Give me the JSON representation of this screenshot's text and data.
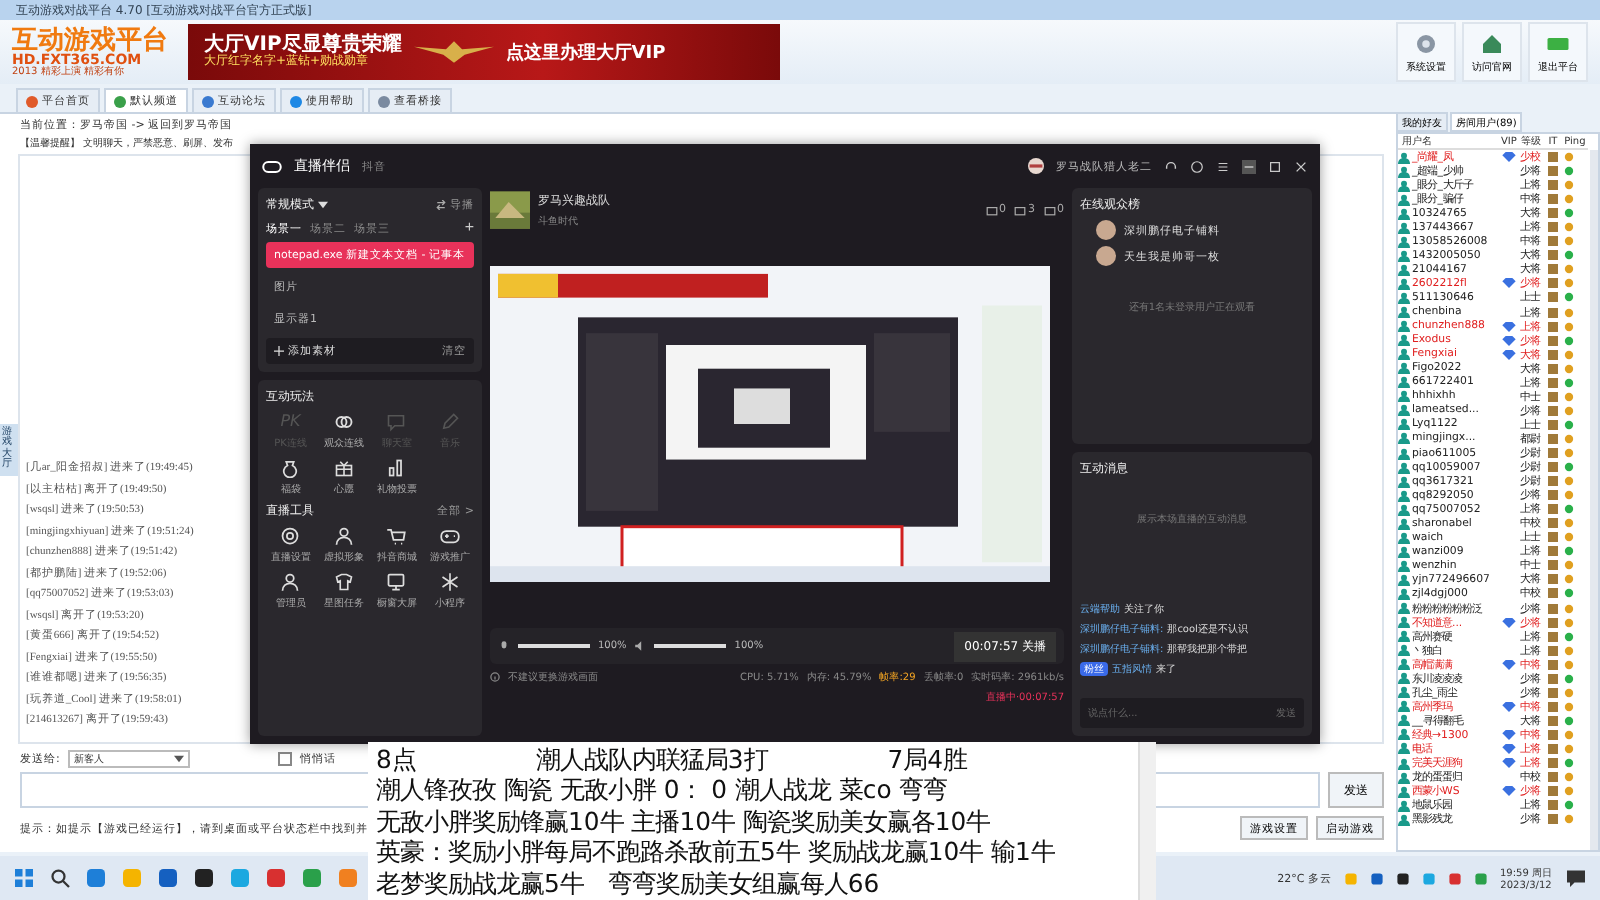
{
  "window": {
    "title": "互动游戏对战平台 4.70 [互动游戏对战平台官方正式版]"
  },
  "logo": {
    "name": "互动游戏平台",
    "url": "HD.FXT365.COM",
    "tagline": "2013 精彩上演 精彩有你"
  },
  "banner": {
    "title": "大厅VIP尽显尊贵荣耀",
    "subtitle": "大厅红字名字+蓝钻+勋战勋章",
    "cta": "点这里办理大厅VIP"
  },
  "toolbar": [
    "系统设置",
    "访问官网",
    "退出平台"
  ],
  "tabs": [
    {
      "label": "平台首页",
      "selected": false
    },
    {
      "label": "默认频道",
      "selected": true
    },
    {
      "label": "互动论坛",
      "selected": false
    },
    {
      "label": "使用帮助",
      "selected": false
    },
    {
      "label": "查看桥接",
      "selected": false
    }
  ],
  "breadcrumb": "当前位置：罗马帝国 -> 返回到罗马帝国",
  "notice": "【温馨提醒】 文明聊天，严禁恶意、刷屏、发布",
  "side_tab": "游戏大厅",
  "log": [
    "[几ar_阳金招叔] 进来了(19:49:45)",
    "[以主枯枯] 离开了(19:49:50)",
    "[wsqsl] 进来了(19:50:53)",
    "[mingjingxhiyuan] 进来了(19:51:24)",
    "[chunzhen888] 进来了(19:51:42)",
    "[都护鹏陆] 进来了(19:52:06)",
    "[qq75007052] 进来了(19:53:03)",
    "[wsqsl] 离开了(19:53:20)",
    "[黄蛋666] 离开了(19:54:52)",
    "[Fengxiai] 进来了(19:55:50)",
    "[谁谁都嗯] 进来了(19:56:35)",
    "[玩养道_Cool] 进来了(19:58:01)",
    "[214613267] 离开了(19:59:43)"
  ],
  "send": {
    "label": "发送给:",
    "target": "新客人",
    "private_label": "悄悄话",
    "private": false,
    "button": "发送"
  },
  "hint": "提示：如提示【游戏已经运行】，请到桌面或平台状态栏中找到并",
  "actions": [
    "游戏设置",
    "启动游戏"
  ],
  "user_panel": {
    "tabs": [
      {
        "label": "我的好友",
        "selected": false
      },
      {
        "label": "房间用户(89)",
        "selected": true
      }
    ],
    "columns": [
      "用户名",
      "VIP",
      "等级",
      "IT",
      "Ping"
    ],
    "users": [
      {
        "name": "_尚耀_凤",
        "highlight": true,
        "vip": true,
        "level": "少校"
      },
      {
        "name": "_超端_少帅",
        "highlight": false,
        "vip": false,
        "level": "少将"
      },
      {
        "name": "_眼分_大斤子",
        "highlight": false,
        "vip": false,
        "level": "上将"
      },
      {
        "name": "_眼分_骗仔",
        "highlight": false,
        "vip": false,
        "level": "中将"
      },
      {
        "name": "10324765",
        "highlight": false,
        "vip": false,
        "level": "大将"
      },
      {
        "name": "137443667",
        "highlight": false,
        "vip": false,
        "level": "上将"
      },
      {
        "name": "13058526008",
        "highlight": false,
        "vip": false,
        "level": "中将"
      },
      {
        "name": "1432005050",
        "highlight": false,
        "vip": false,
        "level": "大将"
      },
      {
        "name": "21044167",
        "highlight": false,
        "vip": false,
        "level": "大将"
      },
      {
        "name": "2602212fl",
        "highlight": true,
        "vip": true,
        "level": "少将"
      },
      {
        "name": "511130646",
        "highlight": false,
        "vip": false,
        "level": "上士"
      },
      {
        "name": "chenbina",
        "highlight": false,
        "vip": false,
        "level": "上将"
      },
      {
        "name": "chunzhen888",
        "highlight": true,
        "vip": true,
        "level": "上将"
      },
      {
        "name": "Exodus",
        "highlight": true,
        "vip": true,
        "level": "少将"
      },
      {
        "name": "Fengxiai",
        "highlight": true,
        "vip": true,
        "level": "大将"
      },
      {
        "name": "Figo2022",
        "highlight": false,
        "vip": false,
        "level": "大将"
      },
      {
        "name": "661722401",
        "highlight": false,
        "vip": false,
        "level": "上将"
      },
      {
        "name": "hhhixhh",
        "highlight": false,
        "vip": false,
        "level": "中士"
      },
      {
        "name": "lameatsed...",
        "highlight": false,
        "vip": false,
        "level": "少将"
      },
      {
        "name": "Lyq1122",
        "highlight": false,
        "vip": false,
        "level": "上士"
      },
      {
        "name": "mingjingx...",
        "highlight": false,
        "vip": false,
        "level": "都尉"
      },
      {
        "name": "piao611005",
        "highlight": false,
        "vip": false,
        "level": "少尉"
      },
      {
        "name": "qq10059007",
        "highlight": false,
        "vip": false,
        "level": "少尉"
      },
      {
        "name": "qq3617321",
        "highlight": false,
        "vip": false,
        "level": "少尉"
      },
      {
        "name": "qq8292050",
        "highlight": false,
        "vip": false,
        "level": "少将"
      },
      {
        "name": "qq75007052",
        "highlight": false,
        "vip": false,
        "level": "上将"
      },
      {
        "name": "sharonabel",
        "highlight": false,
        "vip": false,
        "level": "中校"
      },
      {
        "name": "waich",
        "highlight": false,
        "vip": false,
        "level": "上士"
      },
      {
        "name": "wanzi009",
        "highlight": false,
        "vip": false,
        "level": "上将"
      },
      {
        "name": "wenzhin",
        "highlight": false,
        "vip": false,
        "level": "中士"
      },
      {
        "name": "yjn772496607",
        "highlight": false,
        "vip": false,
        "level": "大将"
      },
      {
        "name": "zjl4dgj000",
        "highlight": false,
        "vip": false,
        "level": "中校"
      },
      {
        "name": "粉粉粉粉粉粉泛",
        "highlight": false,
        "vip": false,
        "level": "少将"
      },
      {
        "name": "不知道意...",
        "highlight": true,
        "vip": true,
        "level": "少将"
      },
      {
        "name": "高州赛硬",
        "highlight": false,
        "vip": false,
        "level": "上将"
      },
      {
        "name": "丶独白",
        "highlight": false,
        "vip": false,
        "level": "上将"
      },
      {
        "name": "高帽满满",
        "highlight": true,
        "vip": true,
        "level": "中将"
      },
      {
        "name": "东川凌凌凌",
        "highlight": false,
        "vip": false,
        "level": "少将"
      },
      {
        "name": "孔尘_雨尘",
        "highlight": false,
        "vip": false,
        "level": "少将"
      },
      {
        "name": "高州季玛",
        "highlight": true,
        "vip": true,
        "level": "中将"
      },
      {
        "name": "__寻得翻毛",
        "highlight": false,
        "vip": false,
        "level": "大将"
      },
      {
        "name": "经典→1300",
        "highlight": true,
        "vip": true,
        "level": "中将"
      },
      {
        "name": "电话",
        "highlight": true,
        "vip": true,
        "level": "上将"
      },
      {
        "name": "完美天涯狗",
        "highlight": true,
        "vip": true,
        "level": "上将"
      },
      {
        "name": "龙的蛋蛋归",
        "highlight": false,
        "vip": false,
        "level": "中校"
      },
      {
        "name": "西蒙小WS",
        "highlight": true,
        "vip": true,
        "level": "少将"
      },
      {
        "name": "地鼠乐园",
        "highlight": false,
        "vip": false,
        "level": "上将"
      },
      {
        "name": "黑影残龙",
        "highlight": false,
        "vip": false,
        "level": "少将"
      }
    ]
  },
  "stream": {
    "title": "直播伴侣",
    "platform": "抖音",
    "user": "罗马战队猎人老二",
    "mode": "常规模式",
    "director": "导播",
    "scenes": [
      {
        "label": "场景一",
        "selected": true
      },
      {
        "label": "场景二",
        "selected": false
      },
      {
        "label": "场景三",
        "selected": false
      }
    ],
    "add_scene": "+",
    "sources": [
      {
        "label": "notepad.exe 新建文本文档 - 记事本",
        "selected": true
      },
      {
        "label": "图片",
        "selected": false
      },
      {
        "label": "显示器1",
        "selected": false
      }
    ],
    "add_source": "添加素材",
    "clear": "清空",
    "interact_title": "互动玩法",
    "interact": [
      {
        "label": "PK连线",
        "glyph": "PK",
        "disabled": true
      },
      {
        "label": "观众连线",
        "disabled": false
      },
      {
        "label": "聊天室",
        "disabled": true
      },
      {
        "label": "音乐",
        "disabled": true
      },
      {
        "label": "福袋",
        "disabled": false
      },
      {
        "label": "心愿",
        "disabled": false
      },
      {
        "label": "礼物投票",
        "disabled": false
      }
    ],
    "tools_title": "直播工具",
    "tools_more": "全部 >",
    "tools": [
      "直播设置",
      "虚拟形象",
      "抖音商城",
      "游戏推广",
      "管理员",
      "星图任务",
      "橱窗大屏",
      "小程序"
    ],
    "room_title": "罗马兴趣战队",
    "room_sub": "斗鱼时代",
    "counters": [
      "0",
      "3",
      "0"
    ],
    "mic": {
      "level": 1,
      "reading": "100%"
    },
    "speaker": {
      "level": 1,
      "reading": "100%"
    },
    "timer": "00:07:57 关播",
    "tip": "不建议更换游戏画面",
    "stats": [
      {
        "text": "CPU: 5.71%",
        "warn": false
      },
      {
        "text": "内存: 45.79%",
        "warn": false
      },
      {
        "text": "帧率:29",
        "warn": true
      },
      {
        "text": "丢帧率:0",
        "warn": false
      },
      {
        "text": "实时码率: 2961kb/s",
        "warn": false
      }
    ],
    "live": "直播中·00:07:57",
    "viewers_title": "在线观众榜",
    "viewers": [
      "深圳鹏仔电子铺料",
      "天生我是帅哥一枚"
    ],
    "viewers_more": "还有1名未登录用户正在观看",
    "messages_title": "互动消息",
    "messages_empty": "展示本场直播的互动消息",
    "messages": [
      {
        "user": "云端帮助",
        "text": "关注了你",
        "fan": false
      },
      {
        "user": "深圳鹏仔电子铺料:",
        "text": "那cool还是不认识",
        "fan": false
      },
      {
        "user": "深圳鹏仔电子铺料:",
        "text": "那帮我把那个带把",
        "fan": false
      },
      {
        "user": "五指风情",
        "text": "来了",
        "fan": true,
        "badge": "粉丝"
      }
    ],
    "input_placeholder": "说点什么...",
    "send": "发送"
  },
  "notepad": [
    "8点　　　　　潮人战队内联猛局3打　　　　　7局4胜",
    "潮人锋孜孜 陶瓷 无敌小胖 0： 0 潮人战龙 菜co 弯弯",
    "无敌小胖奖励锋赢10牛 主播10牛 陶瓷奖励美女赢各10牛",
    "英豪：奖励小胖每局不跑路杀敌前五5牛 奖励战龙赢10牛 输1牛",
    "老梦奖励战龙赢5牛　弯弯奖励美女组赢每人66"
  ],
  "taskbar": {
    "weather": "22°C 多云",
    "time": "19:59 周日",
    "date": "2023/3/12"
  }
}
